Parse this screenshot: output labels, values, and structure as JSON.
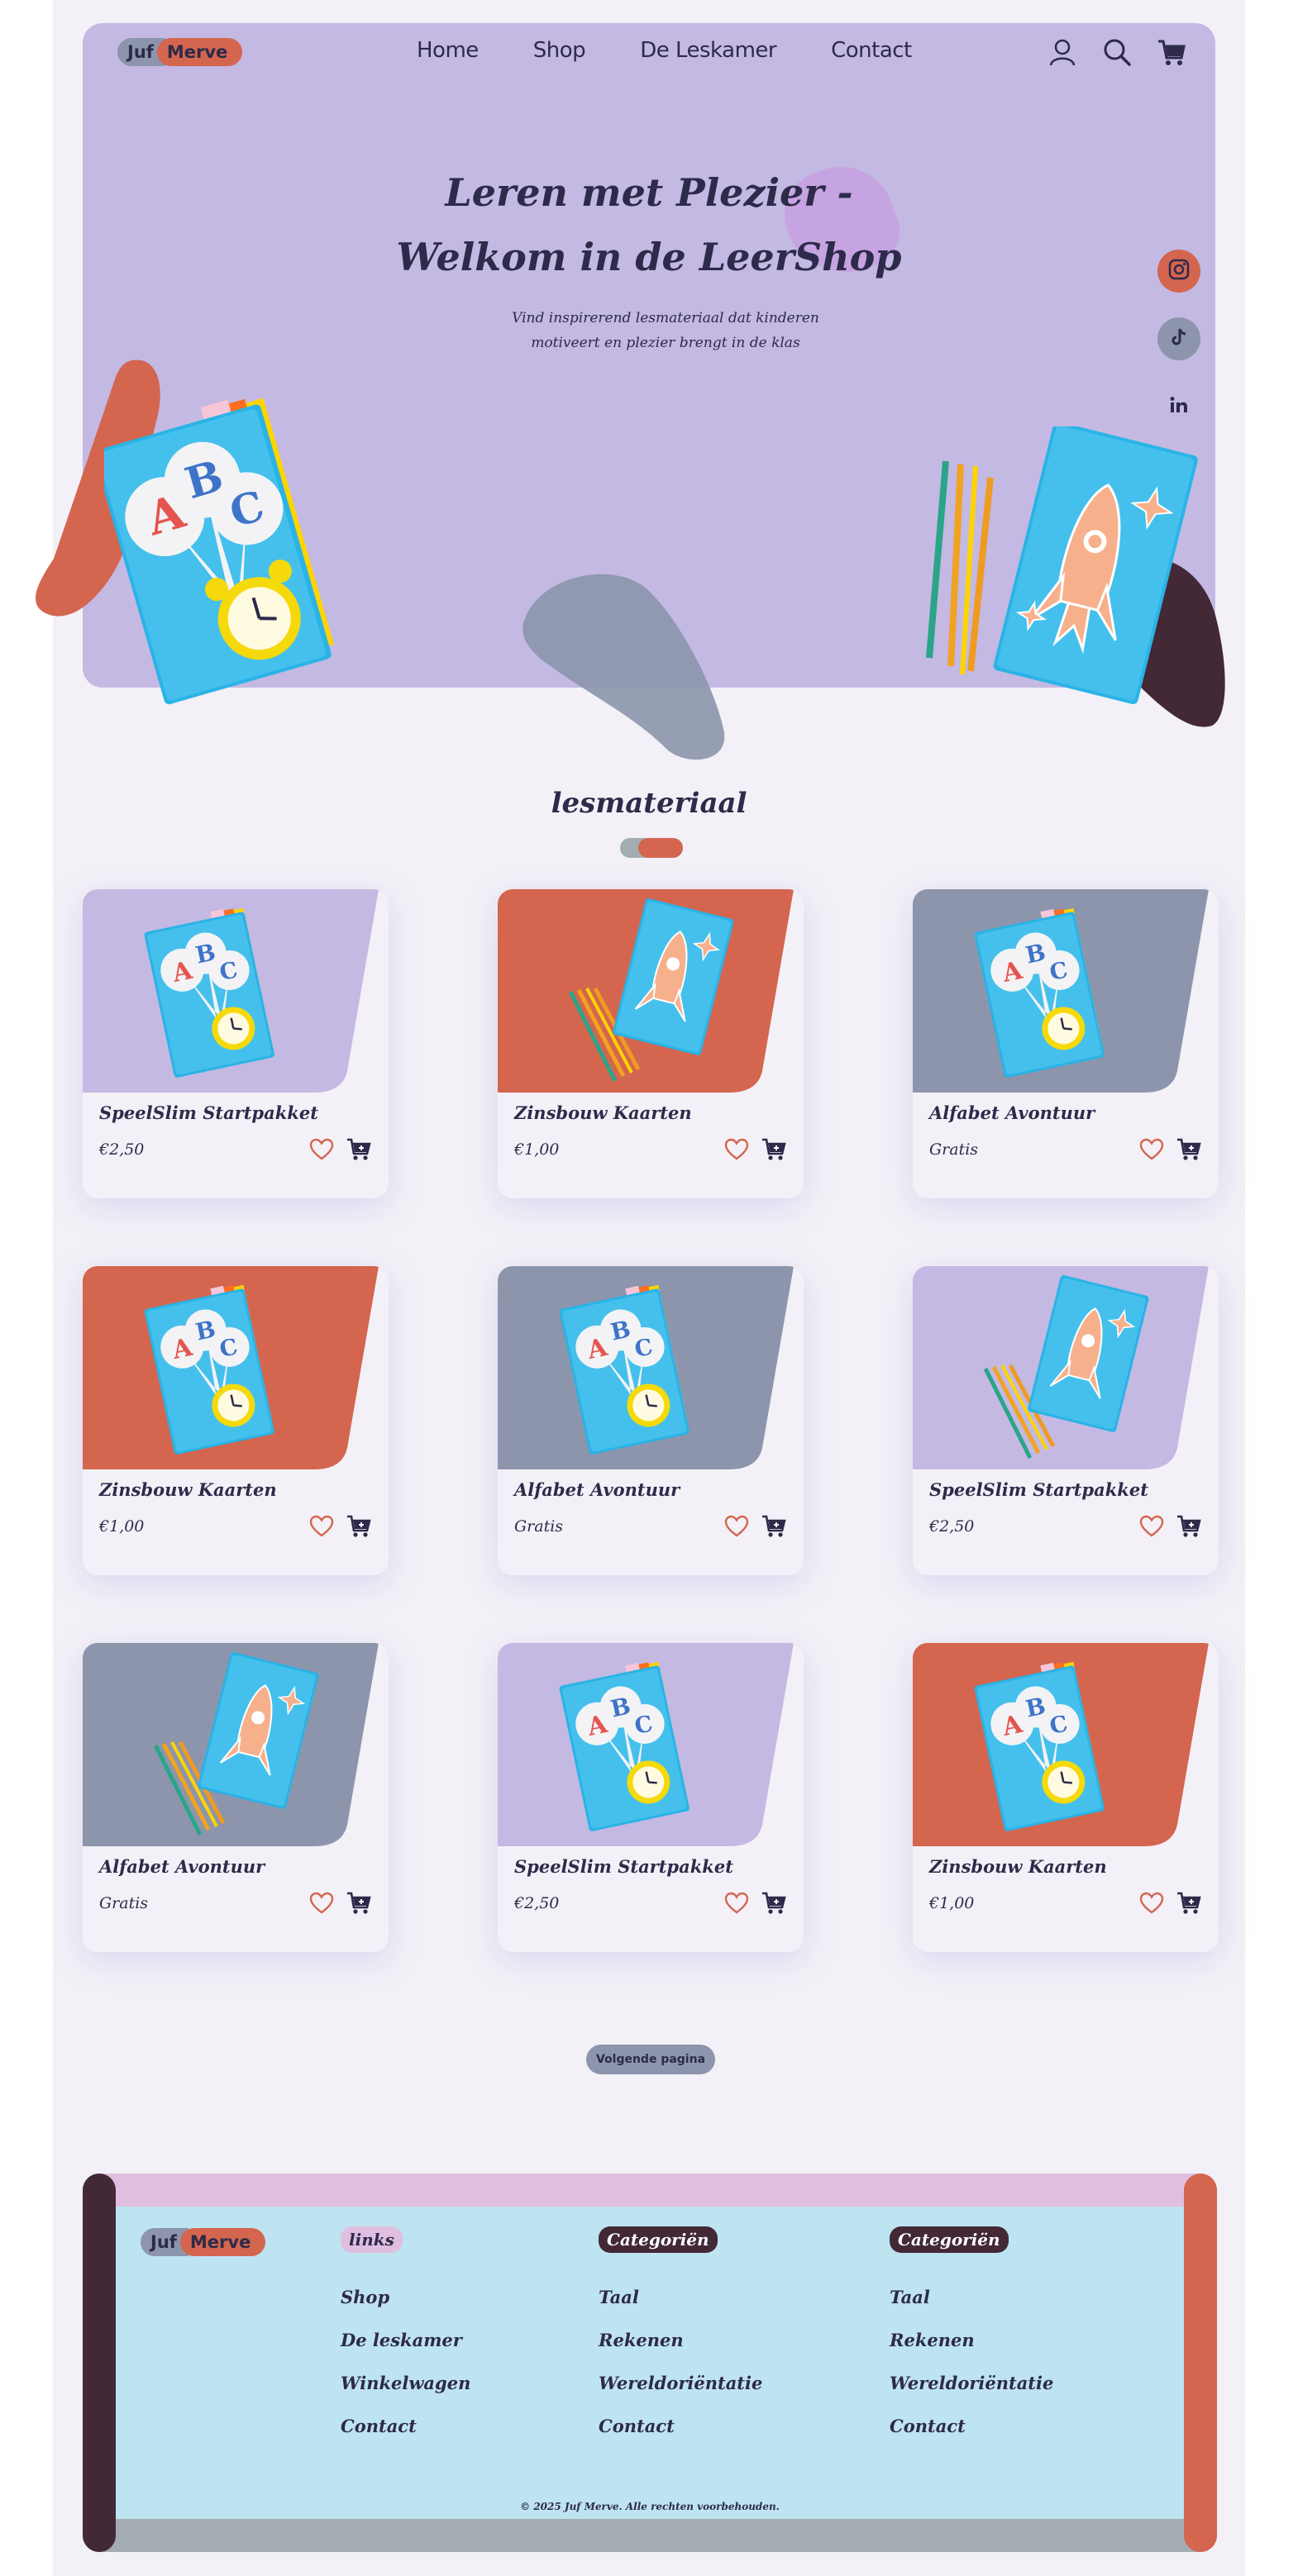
{
  "brand": {
    "part1": "Juf",
    "part2": "Merve"
  },
  "nav": {
    "items": [
      "Home",
      "Shop",
      "De Leskamer",
      "Contact"
    ]
  },
  "hero": {
    "title_line1": "Leren met Plezier -",
    "title_line2": "Welkom in de LeerShop",
    "subtitle_line1": "Vind inspirerend lesmateriaal dat kinderen",
    "subtitle_line2": "motiveert en plezier brengt in de klas"
  },
  "section": {
    "title": "lesmateriaal"
  },
  "products": [
    {
      "name": "SpeelSlim Startpakket",
      "price": "€2,50",
      "bg": "#c3b9e3",
      "art": "abc"
    },
    {
      "name": "Zinsbouw Kaarten",
      "price": "€1,00",
      "bg": "#d4654f",
      "art": "rocket"
    },
    {
      "name": "Alfabet Avontuur",
      "price": "Gratis",
      "bg": "#8c95ac",
      "art": "abc"
    },
    {
      "name": "Zinsbouw Kaarten",
      "price": "€1,00",
      "bg": "#d4654f",
      "art": "abc"
    },
    {
      "name": "Alfabet Avontuur",
      "price": "Gratis",
      "bg": "#8c95ac",
      "art": "abc"
    },
    {
      "name": "SpeelSlim Startpakket",
      "price": "€2,50",
      "bg": "#c3b9e3",
      "art": "rocket"
    },
    {
      "name": "Alfabet Avontuur",
      "price": "Gratis",
      "bg": "#8c95ac",
      "art": "rocket"
    },
    {
      "name": "SpeelSlim Startpakket",
      "price": "€2,50",
      "bg": "#c3b9e3",
      "art": "abc"
    },
    {
      "name": "Zinsbouw Kaarten",
      "price": "€1,00",
      "bg": "#d4654f",
      "art": "abc"
    }
  ],
  "pagination": {
    "next_label": "Volgende pagina"
  },
  "footer": {
    "columns": [
      {
        "heading": "links",
        "heading_bg": "#e0bee0",
        "heading_color": "#2d2a4a",
        "items": [
          "Shop",
          "De leskamer",
          "Winkelwagen",
          "Contact"
        ]
      },
      {
        "heading": "Categoriën",
        "heading_bg": "#432836",
        "heading_color": "#ffffff",
        "items": [
          "Taal",
          "Rekenen",
          "Wereldoriëntatie",
          "Contact"
        ]
      },
      {
        "heading": "Categoriën",
        "heading_bg": "#432836",
        "heading_color": "#ffffff",
        "items": [
          "Taal",
          "Rekenen",
          "Wereldoriëntatie",
          "Contact"
        ]
      }
    ],
    "copyright": "© 2025 Juf Merve. Alle rechten voorbehouden."
  },
  "colors": {
    "lavender": "#c3b9e3",
    "coral": "#d4654f",
    "slate": "#8c95ac",
    "plum": "#432836",
    "sky": "#bee3f1",
    "navy": "#2d2a4a"
  }
}
